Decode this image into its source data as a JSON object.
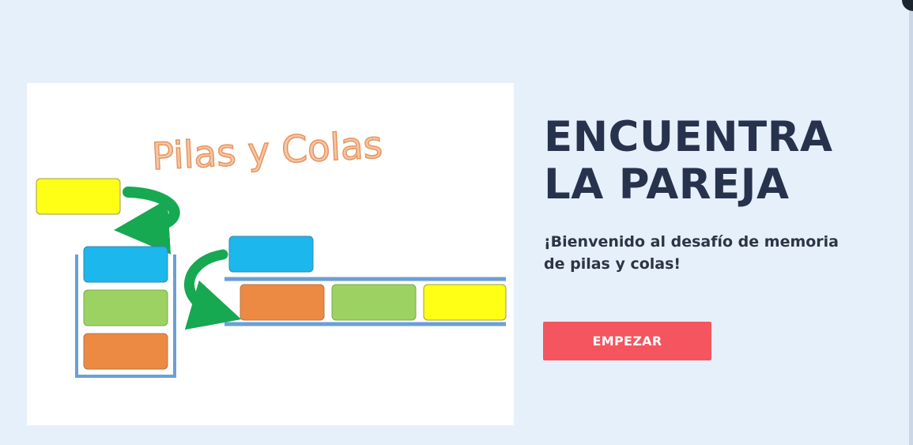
{
  "hero": {
    "image_title": "Pilas y Colas",
    "colors": {
      "yellow": "#ffff16",
      "blue": "#1cb7ec",
      "green": "#9bd261",
      "orange": "#ec8942",
      "arrow_green": "#17a852",
      "title_fill": "#f4c6a7",
      "title_stroke": "#e8955c",
      "container_line": "#6b9fd6"
    }
  },
  "main": {
    "title_line1": "ENCUENTRA",
    "title_line2": "LA PAREJA",
    "welcome": "¡Bienvenido al desafío de memoria de pilas y colas!",
    "start_button": "EMPEZAR"
  },
  "theme": {
    "background": "#e6f0fb",
    "title_color": "#27324d",
    "button_color": "#f4555f"
  }
}
